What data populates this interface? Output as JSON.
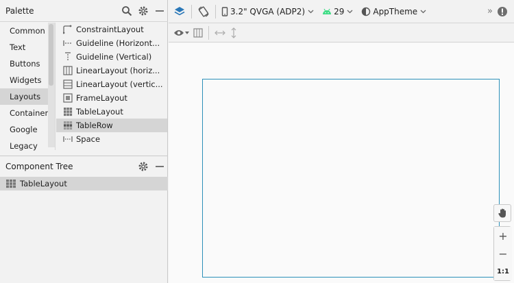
{
  "palette": {
    "title": "Palette",
    "categories": [
      "Common",
      "Text",
      "Buttons",
      "Widgets",
      "Layouts",
      "Containers",
      "Google",
      "Legacy"
    ],
    "selected_category": "Layouts",
    "items": [
      {
        "label": "ConstraintLayout",
        "icon": "constraint-layout-icon"
      },
      {
        "label": "Guideline (Horizont...",
        "icon": "guideline-horizontal-icon"
      },
      {
        "label": "Guideline (Vertical)",
        "icon": "guideline-vertical-icon"
      },
      {
        "label": "LinearLayout (horiz...",
        "icon": "linear-layout-horizontal-icon"
      },
      {
        "label": "LinearLayout (vertic...",
        "icon": "linear-layout-vertical-icon"
      },
      {
        "label": "FrameLayout",
        "icon": "frame-layout-icon"
      },
      {
        "label": "TableLayout",
        "icon": "table-layout-icon"
      },
      {
        "label": "TableRow",
        "icon": "table-row-icon"
      },
      {
        "label": "Space",
        "icon": "space-icon"
      }
    ],
    "selected_item": "TableRow"
  },
  "component_tree": {
    "title": "Component Tree",
    "rows": [
      {
        "label": "TableLayout",
        "icon": "table-layout-icon"
      }
    ]
  },
  "toolbar": {
    "device": "3.2\" QVGA (ADP2)",
    "api_level": "29",
    "theme": "AppTheme",
    "overflow": "»"
  },
  "zoom": {
    "zoom_in": "+",
    "zoom_out": "−",
    "actual_size": "1:1"
  },
  "colors": {
    "accent": "#2b8fb8",
    "android_green": "#3ddc84",
    "selection": "#d5d5d5"
  }
}
